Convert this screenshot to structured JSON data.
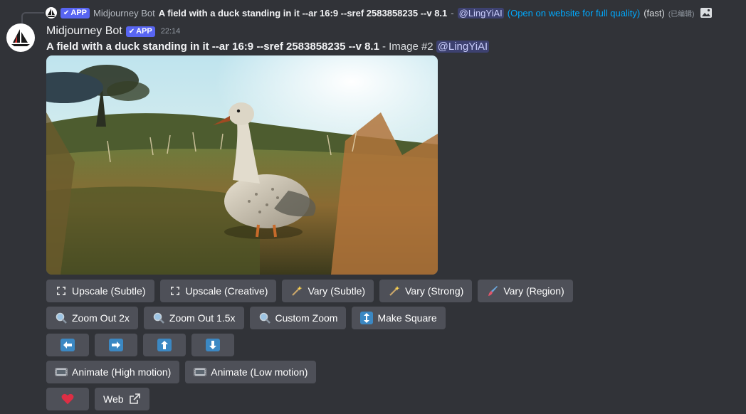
{
  "reply": {
    "author": "Midjourney Bot",
    "app_tag": "APP",
    "prompt": "A field with a duck standing in it --ar 16:9 --sref 2583858235 --v 8.1",
    "dash": "-",
    "mention": "@LingYiAI",
    "link": "(Open on website for full quality)",
    "speed": "(fast)",
    "edited": "(已编辑)"
  },
  "message": {
    "author": "Midjourney Bot",
    "app_tag": "APP",
    "timestamp": "22:14",
    "prompt": "A field with a duck standing in it --ar 16:9 --sref 2583858235 --v 8.1",
    "suffix": "- Image #2",
    "mention": "@LingYiAI"
  },
  "buttons": {
    "row1": [
      {
        "label": "Upscale (Subtle)",
        "icon": "upscale-icon"
      },
      {
        "label": "Upscale (Creative)",
        "icon": "upscale-icon"
      },
      {
        "label": "Vary (Subtle)",
        "icon": "magic-wand-icon"
      },
      {
        "label": "Vary (Strong)",
        "icon": "magic-wand-icon"
      },
      {
        "label": "Vary (Region)",
        "icon": "paintbrush-icon"
      }
    ],
    "row2": [
      {
        "label": "Zoom Out 2x",
        "icon": "magnifier-icon"
      },
      {
        "label": "Zoom Out 1.5x",
        "icon": "magnifier-icon"
      },
      {
        "label": "Custom Zoom",
        "icon": "magnifier-icon"
      },
      {
        "label": "Make Square",
        "icon": "up-down-arrow-icon"
      }
    ],
    "row3": [
      "arrow-left-icon",
      "arrow-right-icon",
      "arrow-up-icon",
      "arrow-down-icon"
    ],
    "row4": [
      {
        "label": "Animate (High motion)",
        "icon": "film-icon"
      },
      {
        "label": "Animate (Low motion)",
        "icon": "film-icon"
      }
    ],
    "row5": {
      "heart_icon": "heart-icon",
      "web_label": "Web",
      "web_icon": "external-link-icon"
    }
  },
  "colors": {
    "background": "#313338",
    "button": "#4e5058",
    "app_tag": "#5865f2",
    "link": "#00a8fc",
    "arrow_button": "#3b88c3",
    "heart": "#dd2e44"
  }
}
